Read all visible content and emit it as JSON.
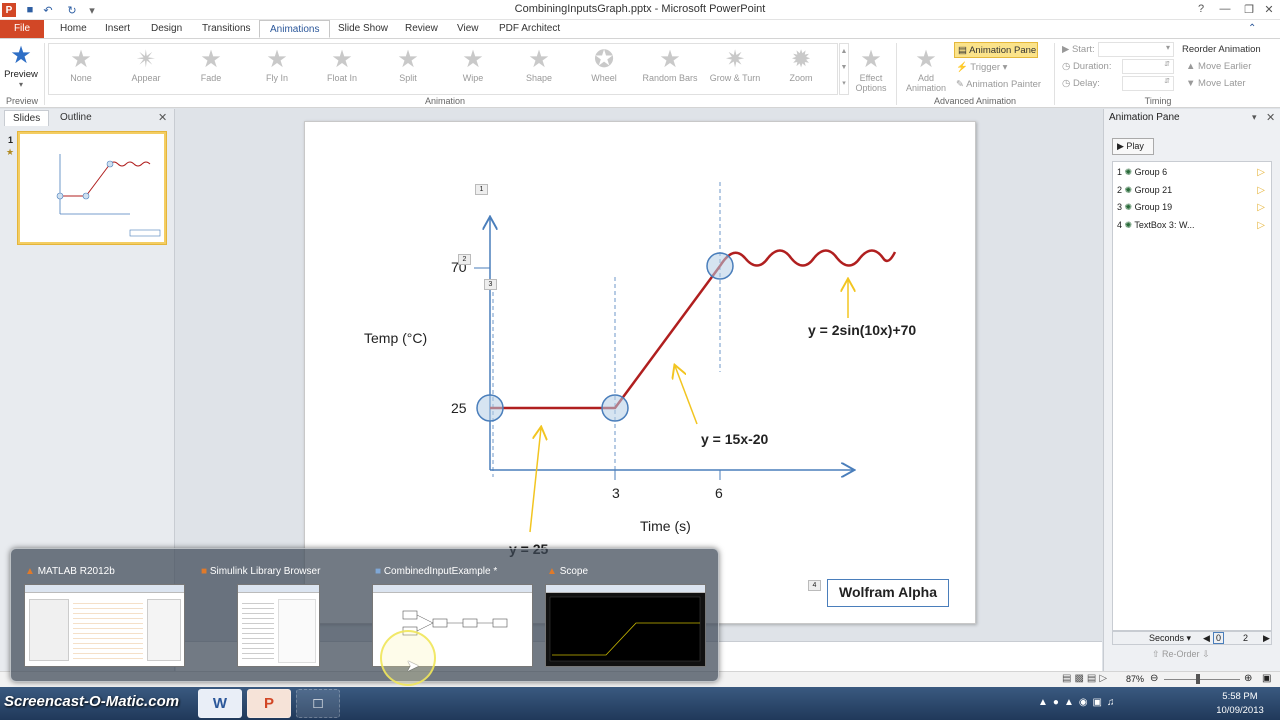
{
  "window": {
    "title": "CombiningInputsGraph.pptx - Microsoft PowerPoint"
  },
  "tabs": [
    "File",
    "Home",
    "Insert",
    "Design",
    "Transitions",
    "Animations",
    "Slide Show",
    "Review",
    "View",
    "PDF Architect"
  ],
  "ribbon": {
    "preview_label": "Preview",
    "preview_group": "Preview",
    "effects": [
      "None",
      "Appear",
      "Fade",
      "Fly In",
      "Float In",
      "Split",
      "Wipe",
      "Shape",
      "Wheel",
      "Random Bars",
      "Grow & Turn",
      "Zoom"
    ],
    "effect_options": "Effect Options",
    "animation_group": "Animation",
    "add_animation": "Add Animation",
    "animation_pane": "Animation Pane",
    "trigger": "Trigger",
    "animation_painter": "Animation Painter",
    "advanced_group": "Advanced Animation",
    "start": "Start:",
    "duration": "Duration:",
    "delay": "Delay:",
    "timing_group": "Timing",
    "reorder": "Reorder Animation",
    "move_earlier": "Move Earlier",
    "move_later": "Move Later"
  },
  "left_pane": {
    "tabs": [
      "Slides",
      "Outline"
    ],
    "slide_number": "1"
  },
  "slide": {
    "y_label": "Temp (°C)",
    "x_label": "Time (s)",
    "y_ticks": [
      "70",
      "25"
    ],
    "x_ticks": [
      "3",
      "6"
    ],
    "eq_sin": "y = 2sin(10x)+70",
    "eq_linear": "y = 15x-20",
    "eq_const": "y = 25",
    "wolfram": "Wolfram Alpha",
    "anim_tags": [
      "1",
      "2",
      "3",
      "4"
    ]
  },
  "animation_pane": {
    "title": "Animation Pane",
    "play": "Play",
    "items": [
      {
        "num": "1",
        "label": "Group 6"
      },
      {
        "num": "2",
        "label": "Group 21"
      },
      {
        "num": "3",
        "label": "Group 19"
      },
      {
        "num": "4",
        "label": "TextBox 3: W..."
      }
    ],
    "seconds": "Seconds",
    "timeline_start": "0",
    "timeline_end": "2",
    "reorder": "Re-Order"
  },
  "switcher": {
    "windows": [
      "MATLAB R2012b",
      "Simulink Library Browser",
      "CombinedInputExample *",
      "Scope"
    ]
  },
  "status": {
    "zoom": "87%"
  },
  "taskbar": {
    "watermark": "Screencast-O-Matic.com",
    "time": "5:58 PM",
    "date": "10/09/2013"
  },
  "colors": {
    "graph_line": "#b01f1f",
    "axis": "#4a7ebb",
    "arrow": "#f2c521",
    "accent": "#d24726"
  }
}
